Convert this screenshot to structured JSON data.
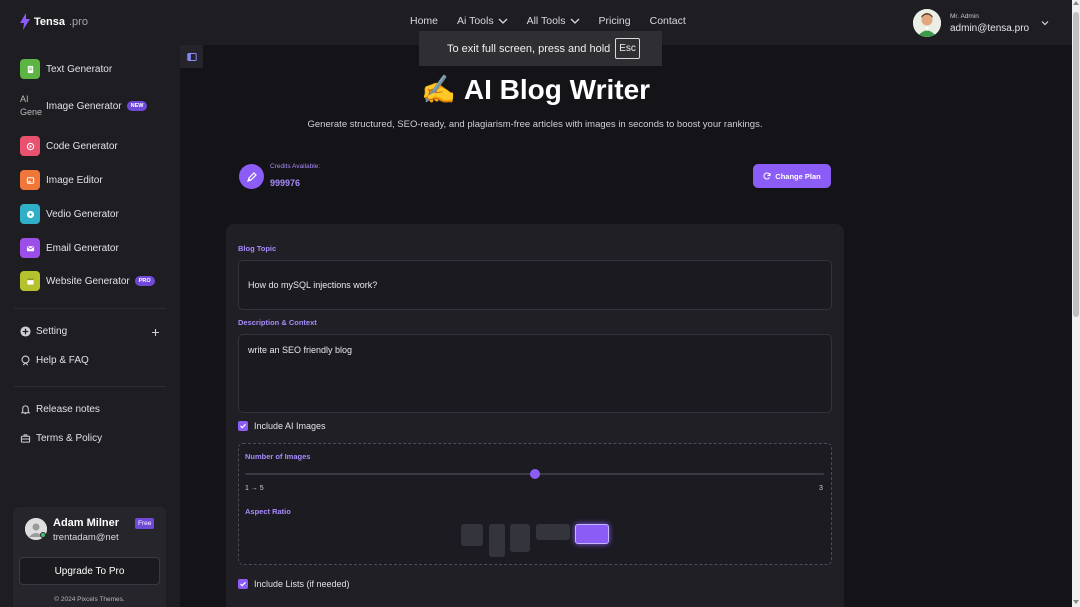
{
  "brand": {
    "name": "Tensa",
    "suffix": ".pro"
  },
  "nav": [
    {
      "label": "Home",
      "dropdown": false
    },
    {
      "label": "Ai Tools",
      "dropdown": true
    },
    {
      "label": "All Tools",
      "dropdown": true
    },
    {
      "label": "Pricing",
      "dropdown": false
    },
    {
      "label": "Contact",
      "dropdown": false
    }
  ],
  "user": {
    "role": "Mr. Admin",
    "email": "admin@tensa.pro"
  },
  "fullscreen_toast": {
    "text": "To exit full screen, press and hold",
    "key": "Esc"
  },
  "sidebar": {
    "tools": [
      {
        "label": "Text Generator",
        "icon": "file-text-icon",
        "color": "#5bb443",
        "badge": ""
      },
      {
        "label": "Image Generator",
        "icon": "broken-image-icon",
        "color": "",
        "badge": "NEW",
        "alt_text": "AI Gene"
      },
      {
        "label": "Code Generator",
        "icon": "code-icon",
        "color": "#e9526e",
        "badge": ""
      },
      {
        "label": "Image Editor",
        "icon": "image-edit-icon",
        "color": "#f0763a",
        "badge": ""
      },
      {
        "label": "Vedio Generator",
        "icon": "video-icon",
        "color": "#2fb0c8",
        "badge": ""
      },
      {
        "label": "Email Generator",
        "icon": "mail-icon",
        "color": "#9b4ee8",
        "badge": ""
      },
      {
        "label": "Website Generator",
        "icon": "website-icon",
        "color": "#b5c22e",
        "badge": "PRO"
      }
    ],
    "settings": {
      "label": "Setting"
    },
    "help": {
      "label": "Help & FAQ"
    },
    "release": {
      "label": "Release notes"
    },
    "terms": {
      "label": "Terms & Policy"
    },
    "profile": {
      "name": "Adam Milner",
      "plan": "Free",
      "email": "trentadam@net",
      "upgrade_label": "Upgrade To Pro",
      "copyright": "© 2024 Pixcels Themes."
    }
  },
  "page": {
    "emoji": "✍️",
    "title": "AI Blog Writer",
    "subtitle": "Generate structured, SEO-ready, and plagiarism-free articles with images in seconds to boost your rankings.",
    "credits_label": "Credits Available:",
    "credits_value": "999976",
    "change_plan_label": "Change Plan"
  },
  "form": {
    "topic_label": "Blog Topic",
    "topic_value": "How do mySQL injections work?",
    "desc_label": "Description & Context",
    "desc_value": "write an SEO friendly blog",
    "include_images_label": "Include AI Images",
    "include_images_checked": true,
    "num_images_label": "Number of Images",
    "range_text": "1 → 5",
    "num_images_value": "3",
    "slider_min": 1,
    "slider_max": 5,
    "slider_value": 3,
    "aspect_label": "Aspect Ratio",
    "aspect_options": [
      "1:1",
      "9:16",
      "3:4",
      "16:9",
      "4:3"
    ],
    "aspect_selected": 4,
    "include_lists_label": "Include Lists (if needed)",
    "include_lists_checked": true
  },
  "colors": {
    "accent": "#8b5cf6",
    "accent_light": "#a78bfa",
    "background": "#131318",
    "panel": "#1d1d22"
  }
}
